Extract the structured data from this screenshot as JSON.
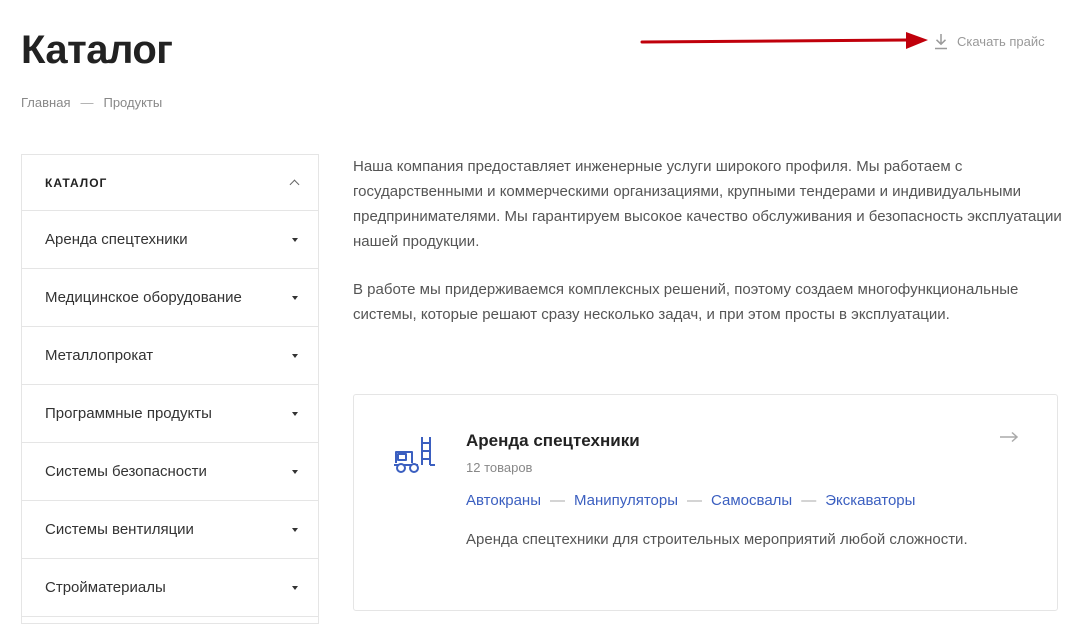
{
  "page": {
    "title": "Каталог"
  },
  "breadcrumb": {
    "items": [
      "Главная",
      "Продукты"
    ],
    "separator": "—"
  },
  "download": {
    "label": "Скачать прайс",
    "icon": "download-icon"
  },
  "annotation": {
    "color": "#c0000b"
  },
  "sidebar": {
    "title": "КАТАЛОГ",
    "items": [
      {
        "label": "Аренда спецтехники"
      },
      {
        "label": "Медицинское оборудование"
      },
      {
        "label": "Металлопрокат"
      },
      {
        "label": "Программные продукты"
      },
      {
        "label": "Системы безопасности"
      },
      {
        "label": "Системы вентиляции"
      },
      {
        "label": "Стройматериалы"
      }
    ]
  },
  "intro": {
    "paragraphs": [
      "Наша компания предоставляет инженерные услуги широкого профиля. Мы работаем с государственными и коммерческими организациями, крупными тендерами и индивидуальными предпринимателями. Мы гарантируем высокое качество обслуживания и безопасность эксплуатации нашей продукции.",
      "В работе мы придерживаемся комплексных решений, поэтому создаем многофункциональные системы, которые решают сразу несколько задач, и при этом просты в эксплуатации."
    ]
  },
  "card": {
    "title": "Аренда спецтехники",
    "count": "12 товаров",
    "icon": "forklift-icon",
    "links": [
      "Автокраны",
      "Манипуляторы",
      "Самосвалы",
      "Экскаваторы"
    ],
    "separator": "—",
    "description": "Аренда спецтехники для строительных мероприятий любой сложности.",
    "accent": "#3b5fc0"
  }
}
